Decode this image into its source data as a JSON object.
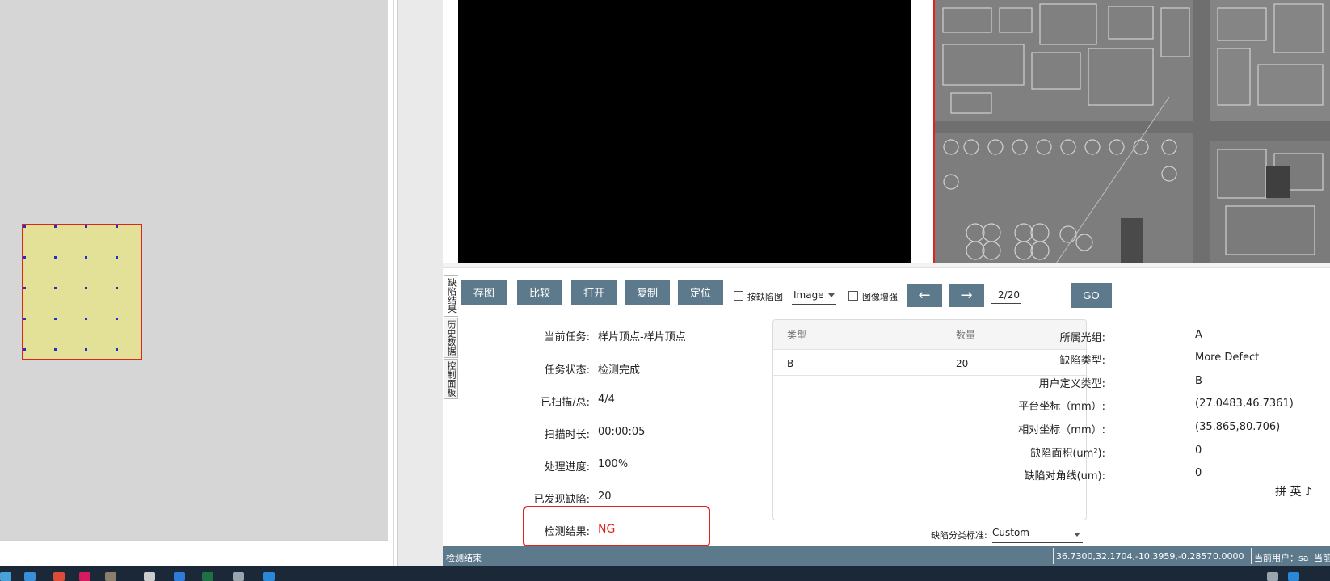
{
  "toolbar": {
    "save_image": "存图",
    "compare": "比较",
    "open": "打开",
    "copy": "复制",
    "locate": "定位",
    "by_defect_map_label": "按缺陷图",
    "image_select_value": "Image",
    "image_enhance_label": "图像增强",
    "prev_arrow": "←",
    "next_arrow": "→",
    "page_indicator": "2/20",
    "go": "GO"
  },
  "side_tabs": {
    "defect_result": "缺陷结果",
    "history_data": "历史数据",
    "control_panel": "控制面板"
  },
  "task_info": {
    "current_task_label": "当前任务:",
    "current_task_value": "样片顶点-样片顶点",
    "task_status_label": "任务状态:",
    "task_status_value": "检测完成",
    "scanned_total_label": "已扫描/总:",
    "scanned_total_value": "4/4",
    "scan_duration_label": "扫描时长:",
    "scan_duration_value": "00:00:05",
    "progress_label": "处理进度:",
    "progress_value": "100%",
    "defects_found_label": "已发现缺陷:",
    "defects_found_value": "20",
    "result_label": "检测结果:",
    "result_value": "NG"
  },
  "defect_table": {
    "headers": [
      "类型",
      "数量"
    ],
    "rows": [
      {
        "type": "B",
        "count": "20"
      }
    ]
  },
  "defect_detail": {
    "optical_group_label": "所属光组:",
    "optical_group_value": "A",
    "defect_type_label": "缺陷类型:",
    "defect_type_value": "More Defect",
    "user_type_label": "用户定义类型:",
    "user_type_value": "B",
    "stage_coord_label": "平台坐标（mm）:",
    "stage_coord_value": "(27.0483,46.7361)",
    "relative_coord_label": "相对坐标（mm）:",
    "relative_coord_value": "(35.865,80.706)",
    "defect_area_label": "缺陷面积(um²):",
    "defect_area_value": "0",
    "defect_diagonal_label": "缺陷对角线(um):",
    "defect_diagonal_value": "0"
  },
  "classification": {
    "label": "缺陷分类标准:",
    "value": "Custom"
  },
  "ime": {
    "text": "拼 英 ♪"
  },
  "status_bar": {
    "left_text": "检测结束",
    "coords": "36.7300,32.1704,-10.3959,-0.2857",
    "value": "0.0000",
    "user": "当前用户：sa",
    "tail": "当前"
  },
  "colors": {
    "button_bg": "#5d7a8c",
    "highlight_red": "#e0231c",
    "ng_text": "#e0231c",
    "sample_fill": "#e3e197"
  }
}
